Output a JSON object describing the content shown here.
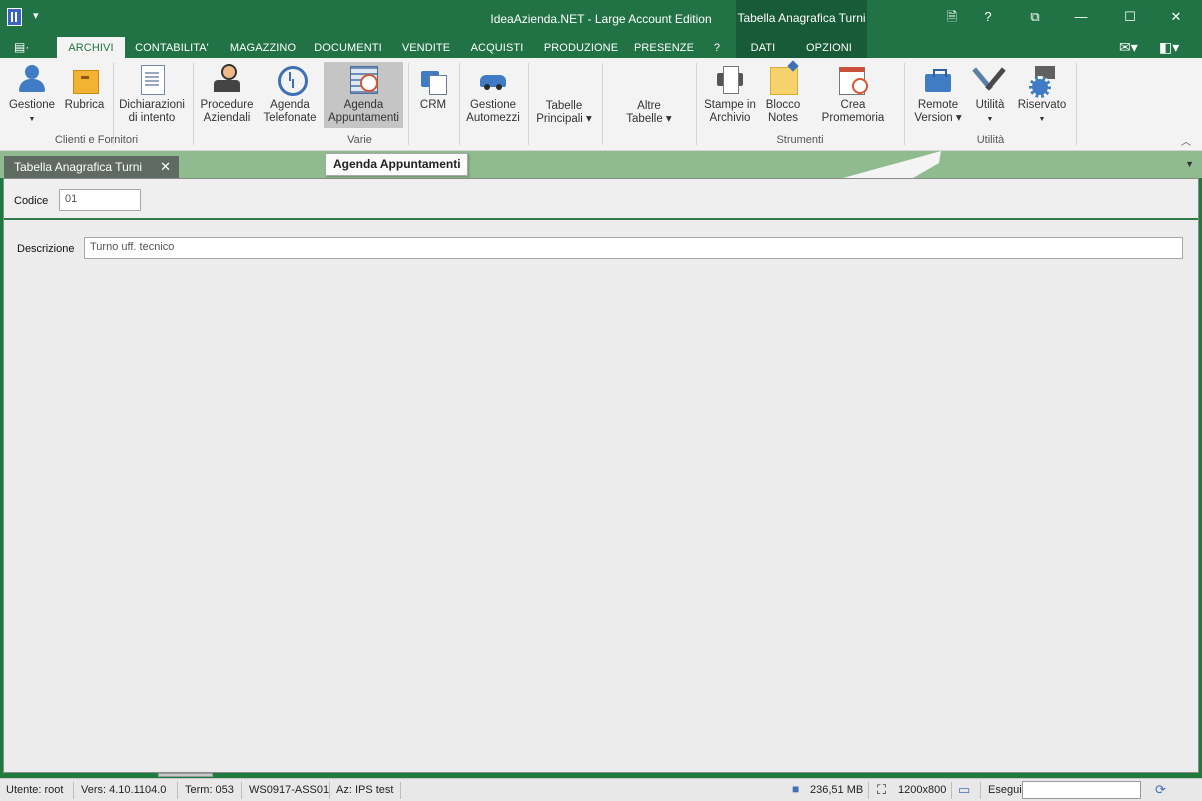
{
  "window": {
    "title": "IdeaAzienda.NET - Large Account Edition",
    "context_title": "Tabella Anagrafica Turni",
    "qa_label": "▾",
    "buttons": {
      "doc": "🗎",
      "help": "?",
      "restore": "⧉",
      "minimize": "—",
      "maximize": "☐",
      "close": "✕"
    }
  },
  "menu": {
    "file_glyph": "▤·",
    "tabs": [
      "ARCHIVI",
      "CONTABILITA'",
      "MAGAZZINO",
      "DOCUMENTI",
      "VENDITE",
      "ACQUISTI",
      "PRODUZIONE",
      "PRESENZE",
      "?",
      "DATI",
      "OPZIONI"
    ],
    "active": "ARCHIVI",
    "right_icons": {
      "mail": "✉▾",
      "layout": "◧▾"
    }
  },
  "ribbon": {
    "buttons": [
      {
        "name": "gestione",
        "line1": "Gestione",
        "line2": "",
        "caret": "▼",
        "icon": "people-icon"
      },
      {
        "name": "rubrica",
        "line1": "Rubrica",
        "line2": "",
        "caret": "",
        "icon": "box-icon"
      },
      {
        "name": "dichiarazioni",
        "line1": "Dichiarazioni",
        "line2": "di intento",
        "caret": "",
        "icon": "document-icon"
      },
      {
        "name": "procedure",
        "line1": "Procedure",
        "line2": "Aziendali",
        "caret": "",
        "icon": "person-icon"
      },
      {
        "name": "agenda-telefonate",
        "line1": "Agenda",
        "line2": "Telefonate",
        "caret": "",
        "icon": "history-icon"
      },
      {
        "name": "agenda-appuntamenti",
        "line1": "Agenda",
        "line2": "Appuntamenti",
        "caret": "",
        "icon": "agenda-icon"
      },
      {
        "name": "crm",
        "line1": "CRM",
        "line2": "",
        "caret": "",
        "icon": "crm-icon"
      },
      {
        "name": "gestione-automezzi",
        "line1": "Gestione",
        "line2": "Automezzi",
        "caret": "",
        "icon": "car-icon"
      },
      {
        "name": "tabelle-principali",
        "line1": "Tabelle",
        "line2": "Principali ▾",
        "caret": "",
        "icon": ""
      },
      {
        "name": "altre-tabelle",
        "line1": "Altre",
        "line2": "Tabelle ▾",
        "caret": "",
        "icon": ""
      },
      {
        "name": "stampe",
        "line1": "Stampe in",
        "line2": "Archivio",
        "caret": "",
        "icon": "printer-icon"
      },
      {
        "name": "blocco-notes",
        "line1": "Blocco",
        "line2": "Notes",
        "caret": "",
        "icon": "notes-icon"
      },
      {
        "name": "crea-promemoria",
        "line1": "Crea Promemoria",
        "line2": "",
        "caret": "",
        "icon": "calendar-icon"
      },
      {
        "name": "remote-version",
        "line1": "Remote",
        "line2": "Version ▾",
        "caret": "",
        "icon": "briefcase-icon"
      },
      {
        "name": "utilita",
        "line1": "Utilità",
        "line2": "",
        "caret": "▼",
        "icon": "tools-icon"
      },
      {
        "name": "riservato",
        "line1": "Riservato",
        "line2": "",
        "caret": "▼",
        "icon": "settings-icon"
      }
    ],
    "groups": {
      "clienti": "Clienti e Fornitori",
      "varie": "Varie",
      "strumenti": "Strumenti",
      "utilita": "Utilità"
    },
    "collapse_glyph": "︿"
  },
  "tooltip": "Agenda Appuntamenti",
  "doc_tab": {
    "label": "Tabella Anagrafica Turni",
    "close": "✕",
    "dropdown": "▼"
  },
  "form": {
    "codice_label": "Codice",
    "codice_value": "01",
    "descrizione_label": "Descrizione",
    "descrizione_value": "Turno uff. tecnico"
  },
  "status": {
    "utente": "Utente: root",
    "versione": "Vers: 4.10.1104.0",
    "term": "Term: 053",
    "ws": "WS0917-ASS01",
    "az": "Az: IPS test",
    "memory": "236,51 MB",
    "resolution": "1200x800",
    "esegui": "Esegui",
    "esegui_value": ""
  }
}
